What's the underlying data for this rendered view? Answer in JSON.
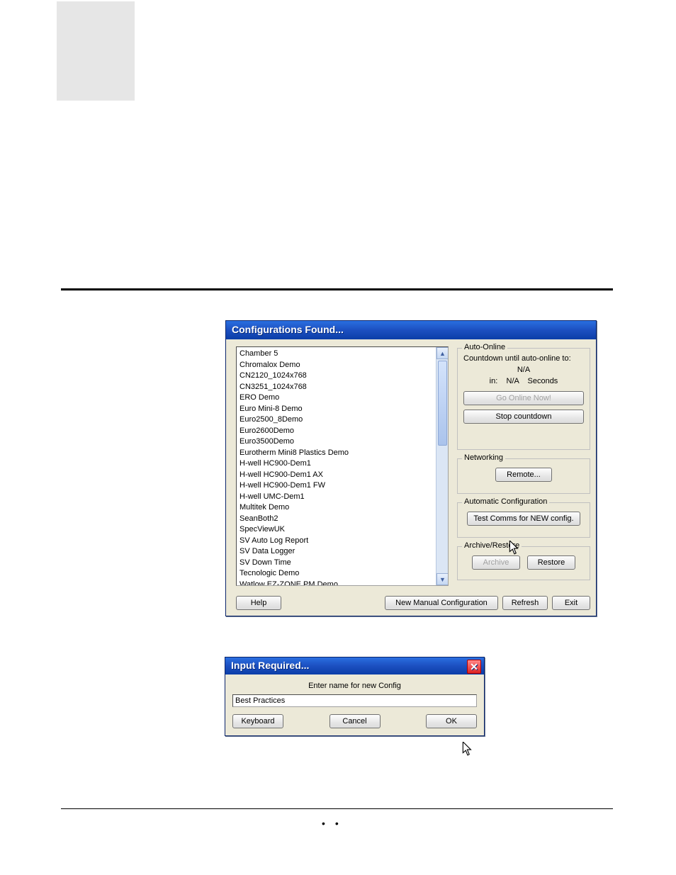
{
  "dialog1": {
    "title": "Configurations Found...",
    "list": [
      "Chamber 5",
      "Chromalox Demo",
      "CN2120_1024x768",
      "CN3251_1024x768",
      "ERO Demo",
      "Euro Mini-8 Demo",
      "Euro2500_8Demo",
      "Euro2600Demo",
      "Euro3500Demo",
      "Eurotherm Mini8 Plastics Demo",
      "H-well HC900-Dem1",
      "H-well HC900-Dem1 AX",
      "H-well HC900-Dem1 FW",
      "H-well UMC-Dem1",
      "Multitek Demo",
      "SeanBoth2",
      "SpecViewUK",
      "SV Auto Log Report",
      "SV Data Logger",
      "SV Down Time",
      "Tecnologic Demo",
      "Watlow EZ-ZONE PM Demo"
    ],
    "auto_online": {
      "legend": "Auto-Online",
      "countdown_label": "Countdown until auto-online to:",
      "target": "N/A",
      "in_label": "in:",
      "in_value": "N/A",
      "seconds_label": "Seconds",
      "go_online": "Go Online Now!",
      "stop": "Stop countdown"
    },
    "networking": {
      "legend": "Networking",
      "remote": "Remote..."
    },
    "autoconf": {
      "legend": "Automatic Configuration",
      "test": "Test Comms for NEW config."
    },
    "archive": {
      "legend": "Archive/Restore",
      "archive": "Archive",
      "restore": "Restore"
    },
    "buttons": {
      "help": "Help",
      "new_manual": "New Manual Configuration",
      "refresh": "Refresh",
      "exit": "Exit"
    }
  },
  "dialog2": {
    "title": "Input Required...",
    "prompt": "Enter name for new Config",
    "value": "Best Practices",
    "keyboard": "Keyboard",
    "cancel": "Cancel",
    "ok": "OK"
  },
  "footer_dots": "••"
}
